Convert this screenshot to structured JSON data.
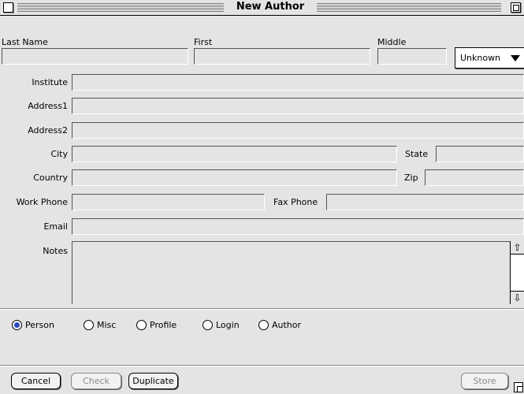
{
  "window": {
    "title": "New Author"
  },
  "fields": {
    "last_name": {
      "label": "Last Name",
      "value": ""
    },
    "first": {
      "label": "First",
      "value": ""
    },
    "middle": {
      "label": "Middle",
      "value": ""
    },
    "suffix_popup": {
      "selected": "Unknown"
    },
    "institute": {
      "label": "Institute",
      "value": ""
    },
    "address1": {
      "label": "Address1",
      "value": ""
    },
    "address2": {
      "label": "Address2",
      "value": ""
    },
    "city": {
      "label": "City",
      "value": ""
    },
    "state": {
      "label": "State",
      "value": ""
    },
    "country": {
      "label": "Country",
      "value": ""
    },
    "zip": {
      "label": "Zip",
      "value": ""
    },
    "work_phone": {
      "label": "Work Phone",
      "value": ""
    },
    "fax_phone": {
      "label": "Fax Phone",
      "value": ""
    },
    "email": {
      "label": "Email",
      "value": ""
    },
    "notes": {
      "label": "Notes",
      "value": ""
    }
  },
  "radios": [
    {
      "label": "Person",
      "selected": true
    },
    {
      "label": "Misc",
      "selected": false
    },
    {
      "label": "Profile",
      "selected": false
    },
    {
      "label": "Login",
      "selected": false
    },
    {
      "label": "Author",
      "selected": false
    }
  ],
  "buttons": {
    "cancel": "Cancel",
    "check": "Check",
    "duplicate": "Duplicate",
    "store": "Store"
  },
  "icons": {
    "close": "close-box-icon",
    "zoom": "zoom-box-icon",
    "scroll_up": "⇧",
    "scroll_down": "⇩",
    "popup_arrow": "triangle-down-icon",
    "grow": "size-box-icon"
  },
  "colors": {
    "radio_selected": "#2a49c2",
    "window_bg": "#e4e4e4"
  }
}
